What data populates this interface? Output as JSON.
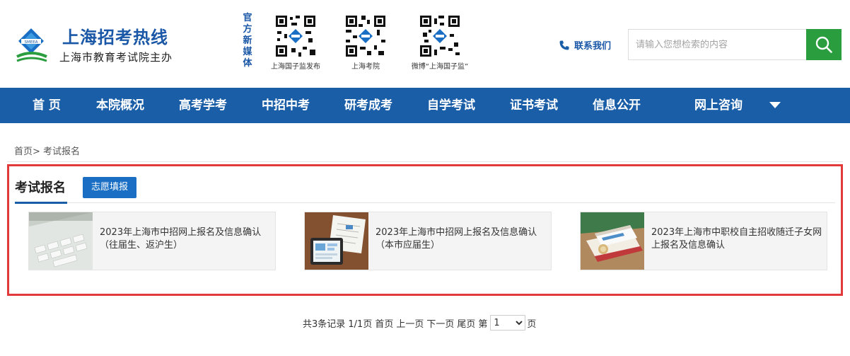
{
  "header": {
    "site_title": "上海招考热线",
    "site_subtitle": "上海市教育考试院主办",
    "media_tag": "官方新媒体",
    "qr_codes": [
      {
        "caption": "上海国子监发布"
      },
      {
        "caption": "上海考院"
      },
      {
        "caption": "微博“上海国子监”"
      }
    ],
    "contact_label": "联系我们",
    "search_placeholder": "请输入您想检索的内容"
  },
  "nav": {
    "items": [
      "首 页",
      "本院概况",
      "高考学考",
      "中招中考",
      "研考成考",
      "自学考试",
      "证书考试",
      "信息公开",
      "网上咨询"
    ]
  },
  "breadcrumb": "首页> 考试报名",
  "panel": {
    "active_tab": "考试报名",
    "secondary_tab": "志愿填报",
    "cards": [
      {
        "title": "2023年上海市中招网上报名及信息确认（往届生、返沪生）"
      },
      {
        "title": "2023年上海市中招网上报名及信息确认（本市应届生）"
      },
      {
        "title": "2023年上海市中职校自主招收随迁子女网上报名及信息确认"
      }
    ]
  },
  "pagination": {
    "summary": "共3条记录 1/1页",
    "first": "首页",
    "prev": "上一页",
    "next": "下一页",
    "last": "尾页",
    "page_prefix": "第",
    "page_value": "1",
    "page_suffix": "页"
  },
  "colors": {
    "brand_blue": "#1a5ea8",
    "search_green": "#2a9d3e",
    "highlight_red": "#e23a3a"
  }
}
